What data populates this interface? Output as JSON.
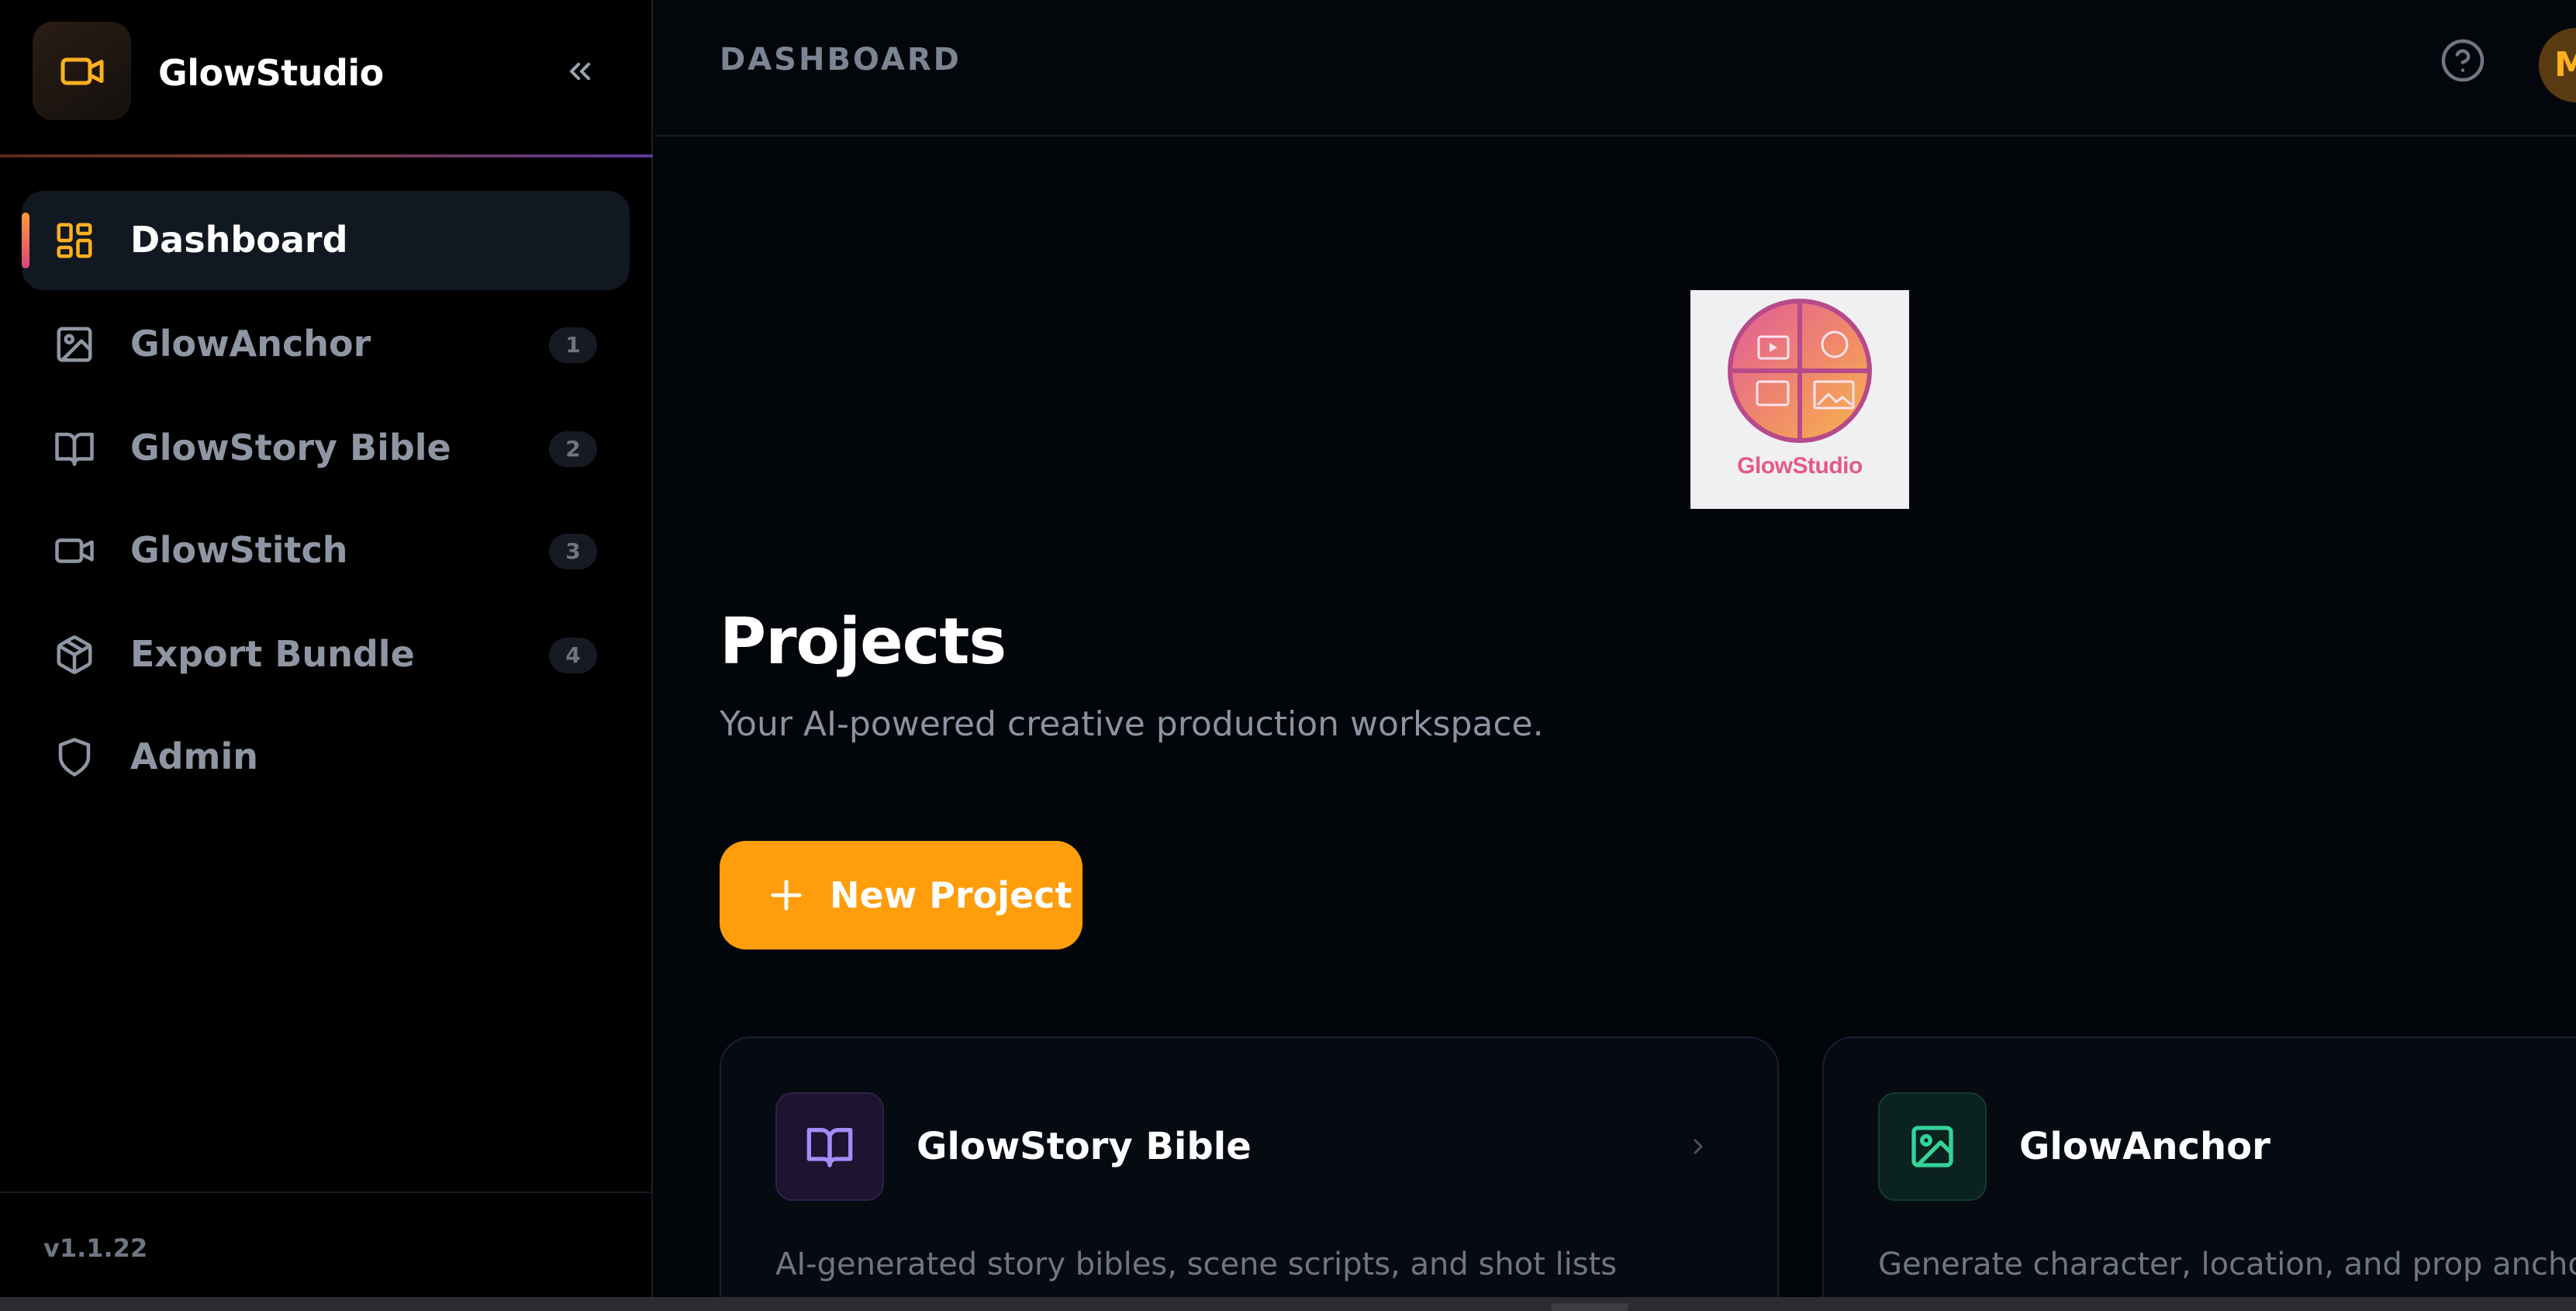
{
  "app": {
    "name": "GlowStudio",
    "version": "v1.1.22"
  },
  "sidebar": {
    "items": [
      {
        "label": "Dashboard",
        "icon": "dashboard-icon",
        "badge": "",
        "active": true
      },
      {
        "label": "GlowAnchor",
        "icon": "image-icon",
        "badge": "1",
        "active": false
      },
      {
        "label": "GlowStory Bible",
        "icon": "book-icon",
        "badge": "2",
        "active": false
      },
      {
        "label": "GlowStitch",
        "icon": "video-icon",
        "badge": "3",
        "active": false
      },
      {
        "label": "Export Bundle",
        "icon": "package-icon",
        "badge": "4",
        "active": false
      },
      {
        "label": "Admin",
        "icon": "shield-icon",
        "badge": "",
        "active": false
      }
    ]
  },
  "topbar": {
    "breadcrumb": "DASHBOARD",
    "avatar_initial": "M"
  },
  "main": {
    "hero_logo_text": "GlowStudio",
    "title": "Projects",
    "subtitle": "Your AI-powered creative production workspace.",
    "new_project_label": "New Project",
    "cards": [
      {
        "title": "GlowStory Bible",
        "description": "AI-generated story bibles, scene scripts, and shot lists",
        "icon": "book-icon"
      },
      {
        "title": "GlowAnchor",
        "description": "Generate character, location, and prop anchor images",
        "icon": "image-icon"
      }
    ]
  },
  "colors": {
    "accent": "#ff9d0a",
    "accent_icon": "#ffb020",
    "purple": "#a78bfa",
    "green": "#34d399",
    "background": "#02050a",
    "sidebar": "#000000"
  }
}
